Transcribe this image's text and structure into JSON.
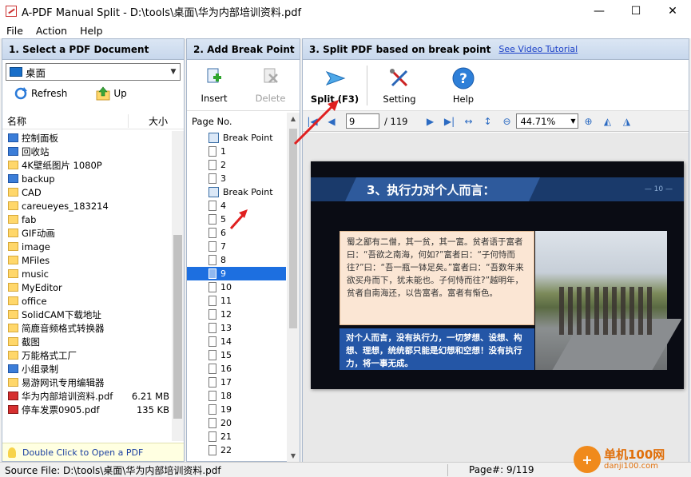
{
  "window": {
    "title": "A-PDF Manual Split - D:\\tools\\桌面\\华为内部培训资料.pdf",
    "minimize": "—",
    "maximize": "☐",
    "close": "✕"
  },
  "menu": [
    "File",
    "Action",
    "Help"
  ],
  "panel1": {
    "header": "1. Select a PDF Document",
    "location": "桌面",
    "refresh_label": "Refresh",
    "up_label": "Up",
    "col_name": "名称",
    "col_size": "大小",
    "files": [
      {
        "name": "控制面板",
        "size": "",
        "icon": "sys"
      },
      {
        "name": "回收站",
        "size": "",
        "icon": "sys"
      },
      {
        "name": "4K壁纸图片 1080P",
        "size": "",
        "icon": "folder"
      },
      {
        "name": "backup",
        "size": "",
        "icon": "sys"
      },
      {
        "name": "CAD",
        "size": "",
        "icon": "folder"
      },
      {
        "name": "careueyes_183214",
        "size": "",
        "icon": "folder"
      },
      {
        "name": "fab",
        "size": "",
        "icon": "folder"
      },
      {
        "name": "GIF动画",
        "size": "",
        "icon": "folder"
      },
      {
        "name": "image",
        "size": "",
        "icon": "folder"
      },
      {
        "name": "MFiles",
        "size": "",
        "icon": "folder"
      },
      {
        "name": "music",
        "size": "",
        "icon": "folder"
      },
      {
        "name": "MyEditor",
        "size": "",
        "icon": "folder"
      },
      {
        "name": "office",
        "size": "",
        "icon": "folder"
      },
      {
        "name": "SolidCAM下载地址",
        "size": "",
        "icon": "folder"
      },
      {
        "name": "简鹿音频格式转换器",
        "size": "",
        "icon": "folder"
      },
      {
        "name": "截图",
        "size": "",
        "icon": "folder"
      },
      {
        "name": "万能格式工厂",
        "size": "",
        "icon": "folder"
      },
      {
        "name": "小组录制",
        "size": "",
        "icon": "sys"
      },
      {
        "name": "易游网讯专用编辑器",
        "size": "",
        "icon": "folder"
      },
      {
        "name": "华为内部培训资料.pdf",
        "size": "6.21 MB",
        "icon": "pdf"
      },
      {
        "name": "停车发票0905.pdf",
        "size": "135 KB",
        "icon": "pdf"
      }
    ],
    "hint": "Double Click to Open a PDF"
  },
  "panel2": {
    "header": "2. Add Break Point",
    "insert_label": "Insert",
    "delete_label": "Delete",
    "col_page": "Page No.",
    "pages": [
      {
        "label": "Break Point",
        "type": "bp"
      },
      {
        "label": "1",
        "type": "page"
      },
      {
        "label": "2",
        "type": "page"
      },
      {
        "label": "3",
        "type": "page"
      },
      {
        "label": "Break Point",
        "type": "bp"
      },
      {
        "label": "4",
        "type": "page"
      },
      {
        "label": "5",
        "type": "page"
      },
      {
        "label": "6",
        "type": "page"
      },
      {
        "label": "7",
        "type": "page"
      },
      {
        "label": "8",
        "type": "page"
      },
      {
        "label": "9",
        "type": "sel"
      },
      {
        "label": "10",
        "type": "page"
      },
      {
        "label": "11",
        "type": "page"
      },
      {
        "label": "12",
        "type": "page"
      },
      {
        "label": "13",
        "type": "page"
      },
      {
        "label": "14",
        "type": "page"
      },
      {
        "label": "15",
        "type": "page"
      },
      {
        "label": "16",
        "type": "page"
      },
      {
        "label": "17",
        "type": "page"
      },
      {
        "label": "18",
        "type": "page"
      },
      {
        "label": "19",
        "type": "page"
      },
      {
        "label": "20",
        "type": "page"
      },
      {
        "label": "21",
        "type": "page"
      },
      {
        "label": "22",
        "type": "page"
      }
    ]
  },
  "panel3": {
    "header": "3. Split PDF based on break point",
    "video_link": "See Video Tutorial",
    "split_label": "Split (F3)",
    "setting_label": "Setting",
    "help_label": "Help",
    "current_page": "9",
    "total_pages": "/ 119",
    "zoom": "44.71%"
  },
  "slide": {
    "title": "3、执行力对个人而言：",
    "number": "— 10 —",
    "quote": "蜀之鄙有二僧，其一贫，其一富。贫者语于富者曰：“吾欲之南海，何如?”富者曰：“子何恃而往?”曰：“吾一瓶一钵足矣。”富者曰：“吾数年来欲买舟而下，犹未能也。子何恃而往?”越明年，贫者自南海还，以告富者。富者有惭色。",
    "blue": "对个人而言，没有执行力，一切梦想、设想、构想、理想，统统都只能是幻想和空想！没有执行力，将一事无成。"
  },
  "status": {
    "source": "Source File: D:\\tools\\桌面\\华为内部培训资料.pdf",
    "page": "Page#: 9/119"
  },
  "watermark": {
    "name": "单机100网",
    "url": "danji100.com"
  },
  "colors": {
    "accent": "#1d6fe0",
    "header_bg": "#c7d7ec",
    "annotation": "#e02020"
  }
}
